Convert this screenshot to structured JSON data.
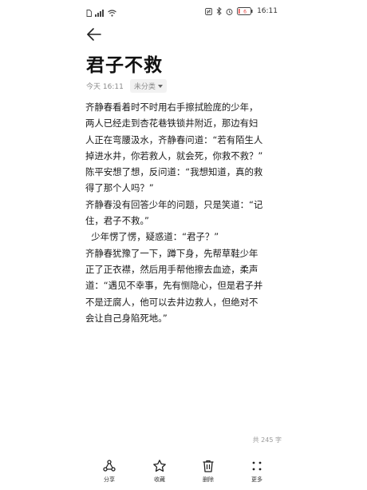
{
  "status_bar": {
    "time": "16:11",
    "battery_level": "6"
  },
  "note": {
    "title": "君子不救",
    "date": "今天 16:11",
    "category": "未分类",
    "paragraphs": [
      "齐静春看着时不时用右手擦拭脸庞的少年，",
      "两人已经走到杏花巷铁锁井附近，那边有妇",
      "人正在弯腰汲水，齐静春问道：“若有陌生人",
      "掉进水井，你若救人，就会死，你救不救？”",
      "陈平安想了想，反问道：“我想知道，真的救",
      "得了那个人吗？”",
      "齐静春没有回答少年的问题，只是笑道：“记",
      "住，君子不救。”",
      "  少年愣了愣，疑惑道：“君子？”",
      "齐静春犹豫了一下，蹲下身，先帮草鞋少年",
      "正了正衣襟，然后用手帮他擦去血迹，柔声",
      "道：“遇见不幸事，先有恻隐心，但是君子并",
      "不是迂腐人，他可以去井边救人，但绝对不",
      "会让自己身陷死地。”"
    ],
    "word_count": "共 245 字"
  },
  "toolbar": {
    "share": "分享",
    "favorite": "收藏",
    "delete": "删除",
    "more": "更多"
  }
}
